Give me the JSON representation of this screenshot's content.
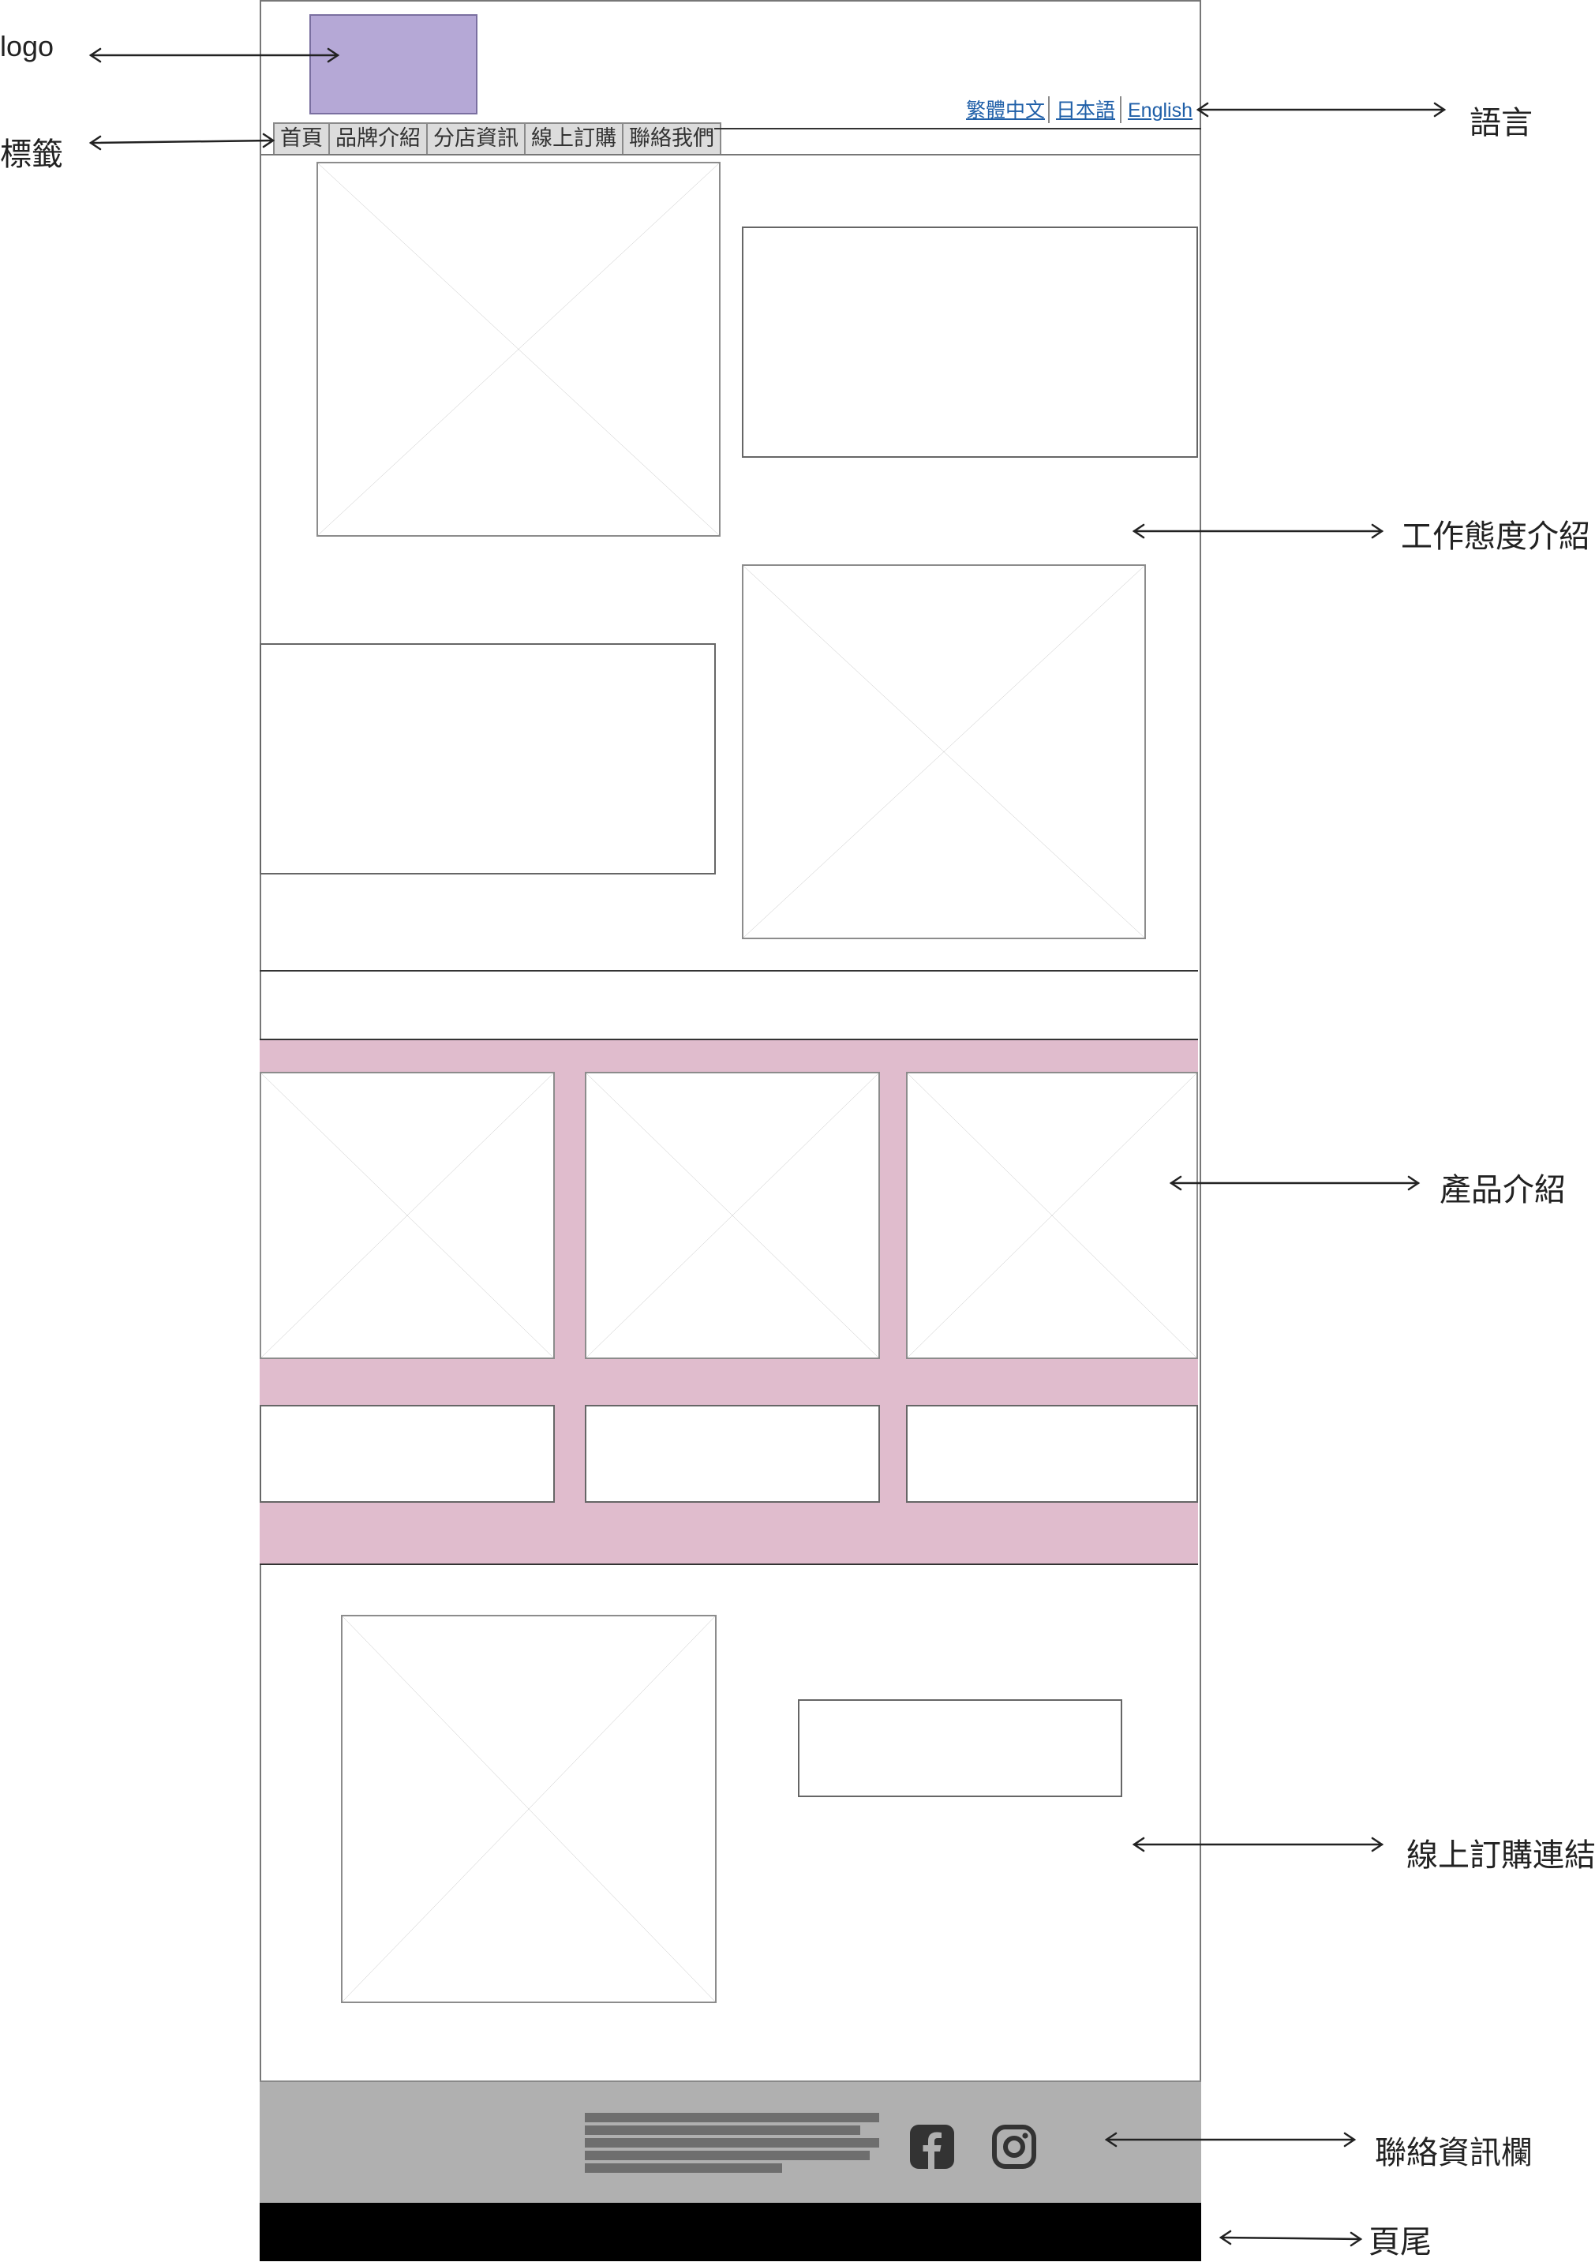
{
  "tabs": [
    "首頁",
    "品牌介紹",
    "分店資訊",
    "線上訂購",
    "聯絡我們"
  ],
  "languages": [
    "繁體中文",
    "日本語",
    "English"
  ],
  "annotations": {
    "logo": "logo",
    "tabs": "標籤",
    "language": "語言",
    "work_attitude": "工作態度介紹",
    "products": "產品介紹",
    "online_order": "線上訂購連結",
    "contact": "聯絡資訊欄",
    "footer": "頁尾"
  },
  "icons": {
    "facebook": "facebook-icon",
    "instagram": "instagram-icon"
  },
  "colors": {
    "logo_fill": "#b5a8d6",
    "product_band": "#e0bccd",
    "contact_bar": "#b0b0b0",
    "footer": "#000000",
    "tab_bg": "#dcdcdc",
    "link": "#1f5fa8"
  }
}
